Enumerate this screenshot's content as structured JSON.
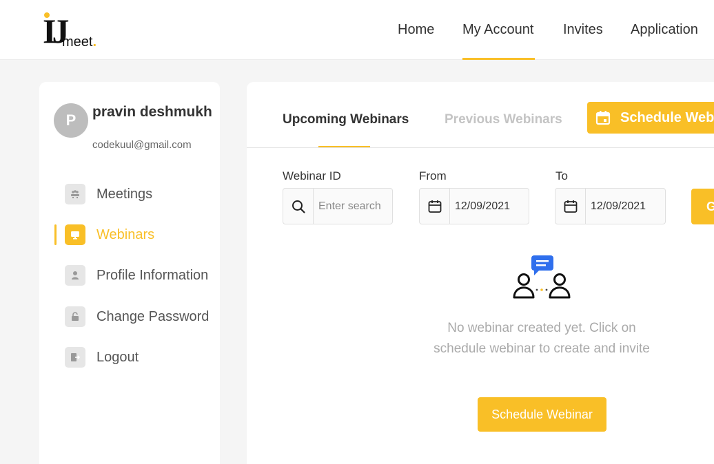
{
  "logo": {
    "mark": "IJ",
    "wordmark": "meet",
    "dot": "."
  },
  "nav": {
    "items": [
      {
        "label": "Home"
      },
      {
        "label": "My Account"
      },
      {
        "label": "Invites"
      },
      {
        "label": "Application"
      }
    ],
    "active": "My Account"
  },
  "user": {
    "initial": "P",
    "name": "pravin deshmukh",
    "email": "codekuul@gmail.com"
  },
  "sidebar": {
    "items": [
      {
        "label": "Meetings",
        "icon": "meeting-icon"
      },
      {
        "label": "Webinars",
        "icon": "webinar-icon"
      },
      {
        "label": "Profile Information",
        "icon": "user-icon"
      },
      {
        "label": "Change Password",
        "icon": "lock-icon"
      },
      {
        "label": "Logout",
        "icon": "logout-icon"
      }
    ],
    "active": "Webinars"
  },
  "tabs": {
    "upcoming": "Upcoming Webinars",
    "previous": "Previous Webinars",
    "active": "Upcoming Webinars"
  },
  "schedule_top_label": "Schedule Webinar",
  "filters": {
    "webinar_id": {
      "label": "Webinar ID",
      "placeholder": "Enter search",
      "value": ""
    },
    "from": {
      "label": "From",
      "value": "12/09/2021"
    },
    "to": {
      "label": "To",
      "value": "12/09/2021"
    },
    "go_label": "G"
  },
  "empty_state": {
    "message": "No webinar created yet. Click on schedule webinar to create and invite",
    "button_label": "Schedule Webinar"
  },
  "colors": {
    "accent": "#f9bf27",
    "chat_bubble": "#2f6fed",
    "background": "#f5f5f5"
  }
}
